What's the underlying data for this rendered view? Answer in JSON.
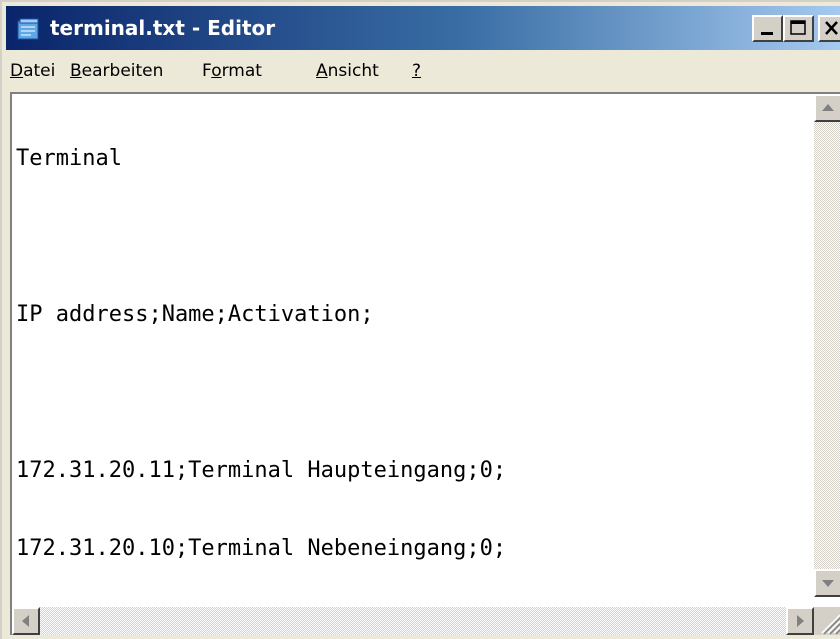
{
  "window": {
    "title": "terminal.txt - Editor",
    "icon": "notepad-icon"
  },
  "titlebar_buttons": [
    {
      "name": "minimize-button",
      "icon": "minimize-icon"
    },
    {
      "name": "maximize-button",
      "icon": "maximize-icon"
    },
    {
      "name": "close-button",
      "icon": "close-icon"
    }
  ],
  "menu": {
    "datei": {
      "accel": "D",
      "rest": "atei"
    },
    "bearbeiten": {
      "accel": "B",
      "rest": "earbeiten"
    },
    "format": {
      "pre": "F",
      "accel": "o",
      "rest": "rmat"
    },
    "ansicht": {
      "accel": "A",
      "rest": "nsicht"
    },
    "help": {
      "accel": "?"
    }
  },
  "document": {
    "lines": [
      "Terminal",
      "",
      "IP address;Name;Activation;",
      "",
      "172.31.20.11;Terminal Haupteingang;0;",
      "172.31.20.10;Terminal Nebeneingang;0;"
    ]
  },
  "colors": {
    "titlebar_start": "#0a246a",
    "titlebar_end": "#a6caf0",
    "chrome": "#ece9d8",
    "editor_bg": "#ffffff"
  }
}
